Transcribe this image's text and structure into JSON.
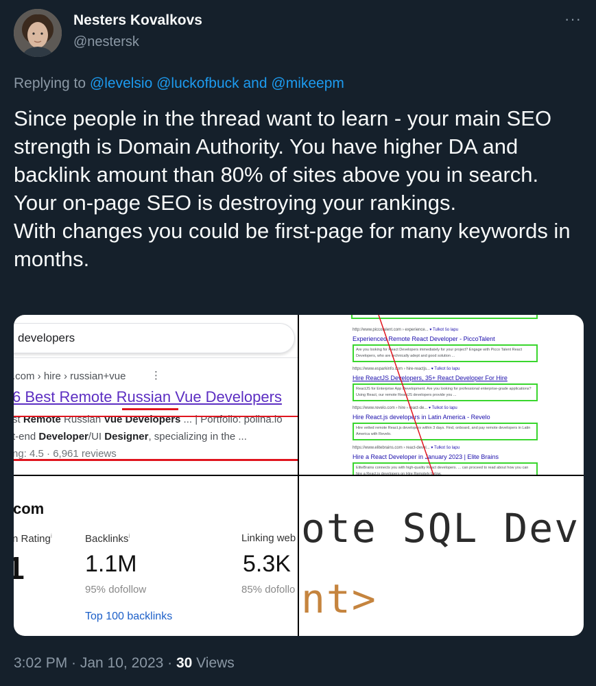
{
  "author": {
    "name": "Nesters Kovalkovs",
    "handle": "@nestersk"
  },
  "more_menu": "···",
  "reply": {
    "prefix": "Replying to",
    "mention1": "@levelsio",
    "mention2": "@luckofbuck",
    "joiner": "and",
    "mention3": "@mikeepm"
  },
  "tweet_text": "Since people in the thread want to learn - your main SEO strength is Domain Authority. You have higher DA and backlink amount than 80% of sites above you in search.\nYour on-page SEO is destroying your rankings.\nWith changes you could be first-page for many keywords in months.",
  "media": {
    "search": {
      "query": "developers",
      "breadcrumb": ".com › hire › russian+vue",
      "kebab": "⋮",
      "title": "6 Best Remote Russian Vue Developers",
      "snippet1_a": "st ",
      "snippet1_b1": "Remote",
      "snippet1_c": " Russian ",
      "snippet1_b2": "Vue Developers",
      "snippet1_d": " ... | Portfolio: polina.io",
      "snippet2_a": "t-end ",
      "snippet2_b": "Developer",
      "snippet2_c": "/UI ",
      "snippet2_b2": "Designer",
      "snippet2_d": ", specializing in the ...",
      "snippet3": "ng: 4.5 · 6,961 reviews"
    },
    "results": [
      {
        "url": "http://www.piccotalent.com › experience... ",
        "translate": "▾ Tulkot šo lapu",
        "title": "Experienced Remote React Developer - PiccoTalent",
        "desc": "Are you looking for React Developers immediately for your project? Engage with Picco Talent React Developers, who are technically adept and good solution ..."
      },
      {
        "url": "https://www.esparkinfo.com › hire-reactjs... ",
        "translate": "▾ Tulkot šo lapu",
        "title": "Hire ReactJS Developers, 35+ React Developer For Hire",
        "desc": "ReactJS for Enterprise App Development. Are you looking for professional enterprise-grade applications? Using React, our remote ReactJS developers provide you ..."
      },
      {
        "url": "https://www.revelo.com › hire › react-de... ",
        "translate": "▾ Tulkot šo lapu",
        "title": "Hire React.js developers in Latin America - Revelo",
        "desc": "Hire vetted remote React.js developers within 3 days. Find, onboard, and pay remote developers in Latin America with Revelo."
      },
      {
        "url": "https://www.elitebrains.com › react-devel... ",
        "translate": "▾ Tulkot šo lapu",
        "title": "Hire a React Developer in January 2023 | Elite Brains",
        "desc": "EliteBrains connects you with high-quality React developers. ... can proceed to read about how you can hire a React.js developers on Hire Remotely below."
      }
    ],
    "metrics": {
      "domain": "com",
      "rating_label": "n Rating",
      "rating_value": "1",
      "backlinks_label": "Backlinks",
      "backlinks_value": "1.1M",
      "backlinks_sub": "95% dofollow",
      "linking_label": "Linking web",
      "linking_value": "5.3K",
      "linking_sub": "85% dofollo",
      "top_link": "Top 100 backlinks",
      "info": "i"
    },
    "code": {
      "line1": "ote SQL Dev",
      "line2": "nt>"
    }
  },
  "footer": {
    "time": "3:02 PM · Jan 10, 2023 · ",
    "views_count": "30",
    "views_label": "Views"
  },
  "colors": {
    "background": "#15202b",
    "link": "#1d9bf0",
    "muted": "#8b98a5",
    "highlight_box": "#39d62d",
    "red_mark": "#e0141e"
  }
}
